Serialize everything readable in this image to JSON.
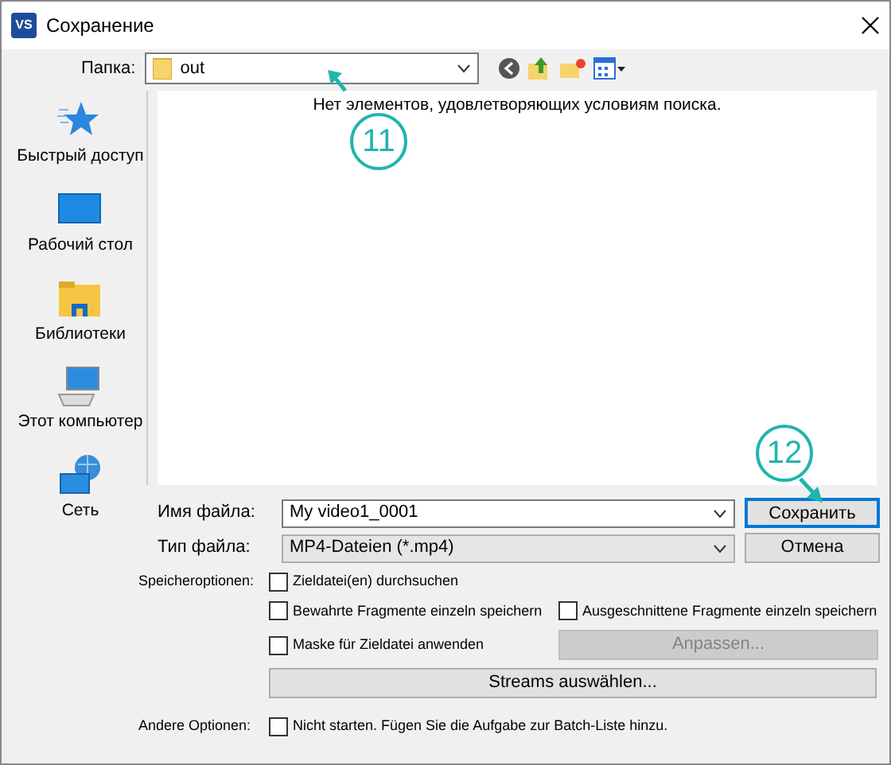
{
  "window": {
    "title": "Сохранение",
    "app_icon": "VS"
  },
  "toolbar": {
    "folder_label": "Папка:",
    "folder": "out"
  },
  "places": [
    {
      "kind": "star",
      "label": "Быстрый доступ"
    },
    {
      "kind": "desktop",
      "label": "Рабочий стол"
    },
    {
      "kind": "library",
      "label": "Библиотеки"
    },
    {
      "kind": "computer",
      "label": "Этот компьютер"
    },
    {
      "kind": "network",
      "label": "Сеть"
    }
  ],
  "file_list": {
    "empty_message": "Нет элементов, удовлетворяющих условиям поиска."
  },
  "filename": {
    "label": "Имя файла:",
    "value": "My video1_0001"
  },
  "filetype": {
    "label": "Тип файла:",
    "value": "MP4-Dateien (*.mp4)"
  },
  "buttons": [
    {
      "label": "Сохранить",
      "default": true
    },
    {
      "label": "Отмена",
      "default": false
    }
  ],
  "save_options": {
    "label": "Speicheroptionen:",
    "checkboxes": [
      {
        "label": "Zieldatei(en) durchsuchen",
        "checked": false
      },
      {
        "label": "Bewahrte Fragmente einzeln speichern",
        "checked": false
      },
      {
        "label": "Ausgeschnittene Fragmente einzeln speichern",
        "checked": false
      },
      {
        "label": "Maske für Zieldatei anwenden",
        "checked": false
      }
    ]
  },
  "adjust_button": {
    "label": "Anpassen...",
    "disabled": true
  },
  "streams_button": {
    "label": "Streams auswählen..."
  },
  "other_options": {
    "label": "Andere Optionen:",
    "checkbox": {
      "label": "Nicht starten. Fügen Sie die Aufgabe zur Batch-Liste hinzu.",
      "checked": false
    }
  },
  "callouts": [
    {
      "number": "11"
    },
    {
      "number": "12"
    }
  ]
}
